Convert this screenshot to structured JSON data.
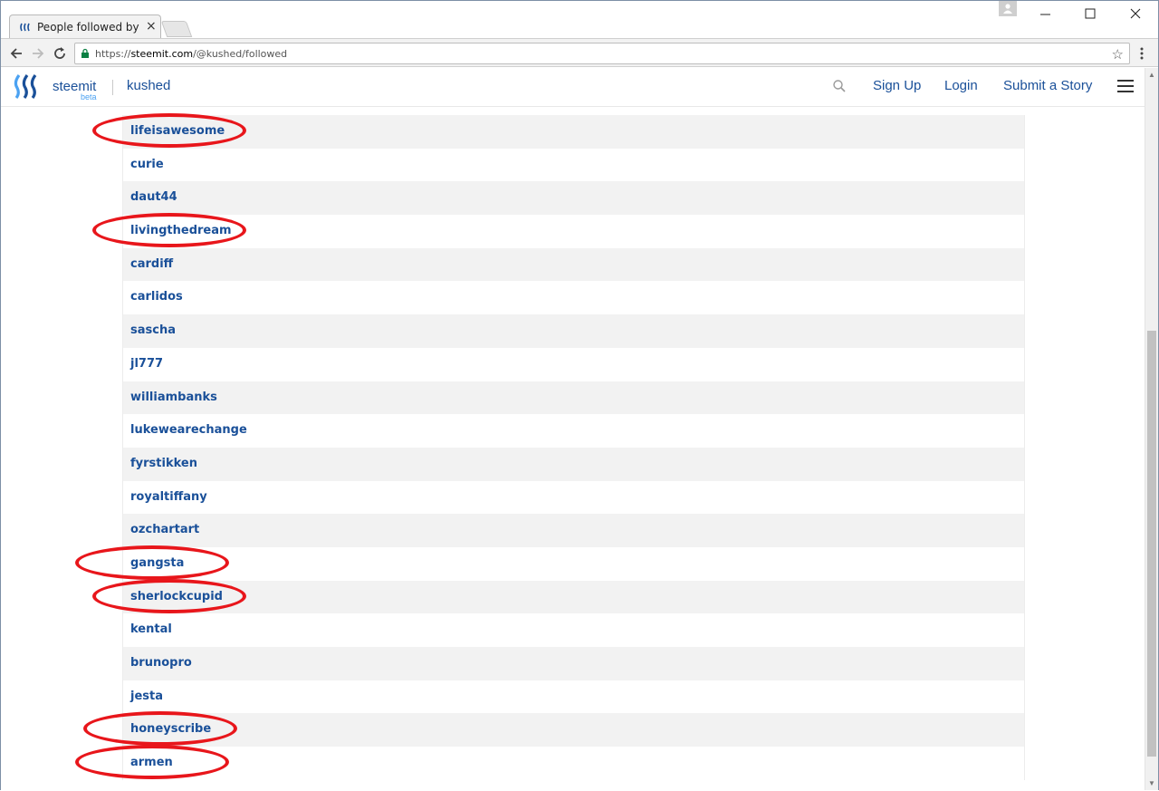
{
  "browser": {
    "tab_title": "People followed by",
    "tab_close": "×",
    "url_scheme": "https://",
    "url_host": "steemit.com",
    "url_path": "/@kushed/followed"
  },
  "header": {
    "brand": "steemit",
    "beta": "beta",
    "username": "kushed",
    "signup": "Sign Up",
    "login": "Login",
    "submit": "Submit a Story"
  },
  "users": [
    {
      "name": "lifeisawesome",
      "circled": true
    },
    {
      "name": "curie",
      "circled": false
    },
    {
      "name": "daut44",
      "circled": false
    },
    {
      "name": "livingthedream",
      "circled": true
    },
    {
      "name": "cardiff",
      "circled": false
    },
    {
      "name": "carlidos",
      "circled": false
    },
    {
      "name": "sascha",
      "circled": false
    },
    {
      "name": "jl777",
      "circled": false
    },
    {
      "name": "williambanks",
      "circled": false
    },
    {
      "name": "lukewearechange",
      "circled": false
    },
    {
      "name": "fyrstikken",
      "circled": false
    },
    {
      "name": "royaltiffany",
      "circled": false
    },
    {
      "name": "ozchartart",
      "circled": false
    },
    {
      "name": "gangsta",
      "circled": true
    },
    {
      "name": "sherlockcupid",
      "circled": true
    },
    {
      "name": "kental",
      "circled": false
    },
    {
      "name": "brunopro",
      "circled": false
    },
    {
      "name": "jesta",
      "circled": false
    },
    {
      "name": "honeyscribe",
      "circled": true
    },
    {
      "name": "armen",
      "circled": true
    }
  ],
  "colors": {
    "link": "#1a5099",
    "annotation_ring": "#e8161b",
    "row_alt": "#f2f2f2"
  }
}
